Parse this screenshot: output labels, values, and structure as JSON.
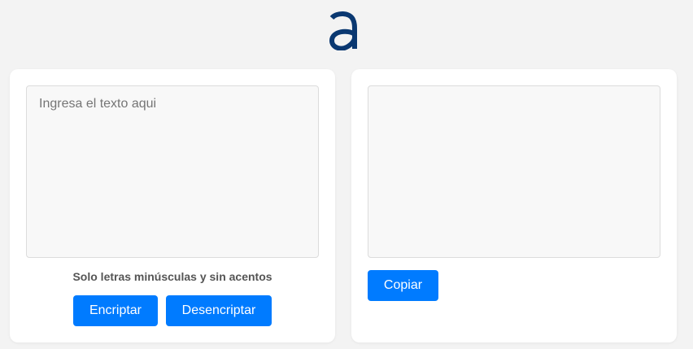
{
  "logo": {
    "icon": "logo-a-icon",
    "color": "#0a3871"
  },
  "input_panel": {
    "placeholder": "Ingresa el texto aqui",
    "value": "",
    "hint": "Solo letras minúsculas y sin acentos",
    "encrypt_label": "Encriptar",
    "decrypt_label": "Desencriptar"
  },
  "output_panel": {
    "value": "",
    "copy_label": "Copiar"
  },
  "colors": {
    "accent": "#007bff",
    "background": "#f3f3f3",
    "card": "#ffffff"
  }
}
